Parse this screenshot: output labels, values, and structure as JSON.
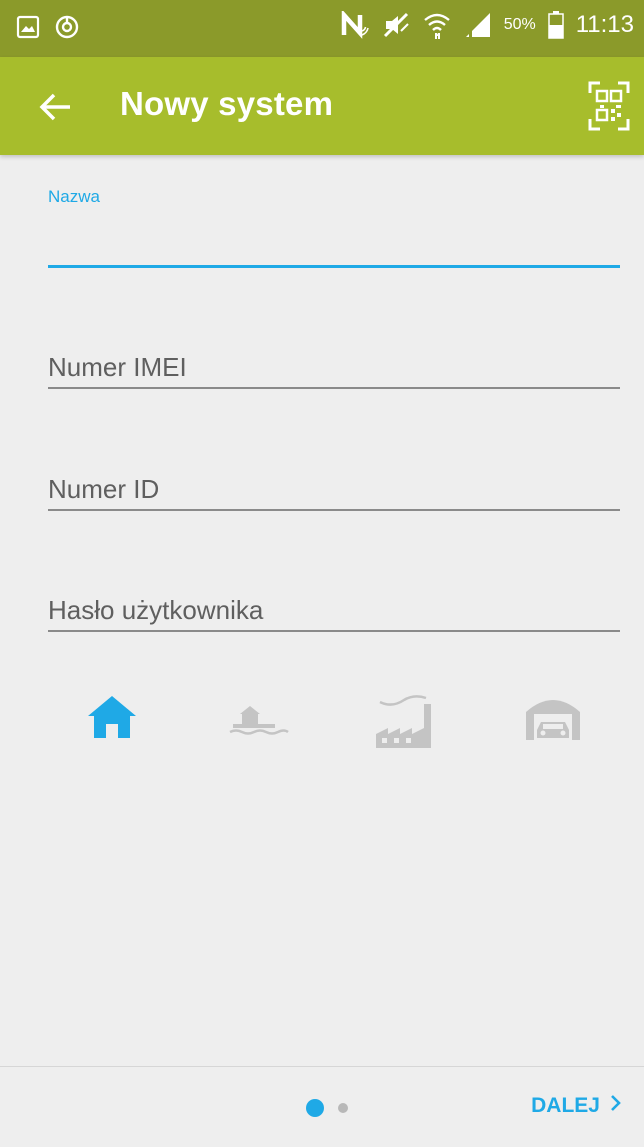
{
  "status_bar": {
    "battery_percent": "50%",
    "time": "11:13"
  },
  "app_bar": {
    "title": "Nowy system"
  },
  "form": {
    "name_label": "Nazwa",
    "imei_placeholder": "Numer IMEI",
    "id_placeholder": "Numer ID",
    "password_placeholder": "Hasło użytkownika"
  },
  "system_types": [
    {
      "icon": "house-icon",
      "selected": true
    },
    {
      "icon": "house-on-water-icon",
      "selected": false
    },
    {
      "icon": "factory-icon",
      "selected": false
    },
    {
      "icon": "garage-icon",
      "selected": false
    }
  ],
  "bottom": {
    "next_label": "DALEJ",
    "page_count": 2,
    "current_page": 1
  },
  "colors": {
    "status_bar": "#8b9a2a",
    "app_bar": "#a7bd2c",
    "accent": "#1fa9e6",
    "inactive_icon": "#c4c4c4",
    "background": "#eeeeee"
  }
}
